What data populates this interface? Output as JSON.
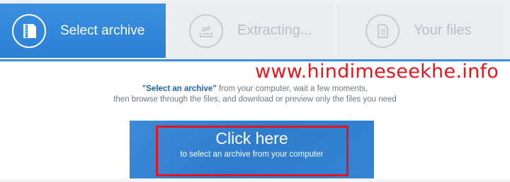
{
  "tabs": [
    {
      "label": "Select archive",
      "icon": "archive-file-icon",
      "state": "active"
    },
    {
      "label": "Extracting...",
      "icon": "extract-tray-icon",
      "state": "inactive"
    },
    {
      "label": "Your files",
      "icon": "document-icon",
      "state": "inactive"
    }
  ],
  "watermark": "www.hindimeseekhe.info",
  "intro": {
    "emphasis": "\"Select an archive\"",
    "line1_rest": " from your computer, wait a few moments,",
    "line2": "then browse through the files, and download or preview only the files you need"
  },
  "cta": {
    "title": "Click here",
    "subtitle": "to select an archive from your computer"
  },
  "colors": {
    "accent": "#2d7fd4",
    "inactive_text": "#b9bfc7",
    "highlight_red": "#e4141a",
    "emphasis_blue": "#1f63b8"
  }
}
